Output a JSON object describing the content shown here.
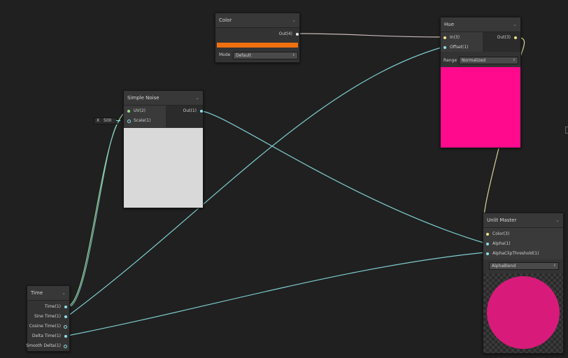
{
  "nodes": {
    "color": {
      "title": "Color",
      "out_label": "Out(4)",
      "swatch_color": "#f07010",
      "mode_label": "Mode",
      "mode_value": "Default"
    },
    "hue": {
      "title": "Hue",
      "in_label": "In(3)",
      "offset_label": "Offset(1)",
      "out_label": "Out(3)",
      "range_label": "Range",
      "range_value": "Normalized",
      "preview_color": "#ff0a8c"
    },
    "simple_noise": {
      "title": "Simple Noise",
      "uv_label": "UV(2)",
      "scale_label": "Scale(1)",
      "out_label": "Out(1)",
      "scale_axis": "X",
      "scale_value": "500",
      "preview_color": "#d9d9d9"
    },
    "time": {
      "title": "Time",
      "outputs": [
        "Time(1)",
        "Sine Time(1)",
        "Cosine Time(1)",
        "Delta Time(1)",
        "Smooth Delta(1)"
      ]
    },
    "unlit_master": {
      "title": "Unlit Master",
      "color_label": "Color(3)",
      "alpha_label": "Alpha(1)",
      "alpha_clip_label": "AlphaClipThreshold(1)",
      "blend_value": "AlphaBlend",
      "preview_color": "#d81b7a"
    }
  },
  "colors": {
    "background": "#202020",
    "wire_vector": "#c8b8b8",
    "wire_cyan": "#7ecdd0",
    "wire_yellow": "#d8d49a",
    "wire_green": "#9ed49a"
  }
}
